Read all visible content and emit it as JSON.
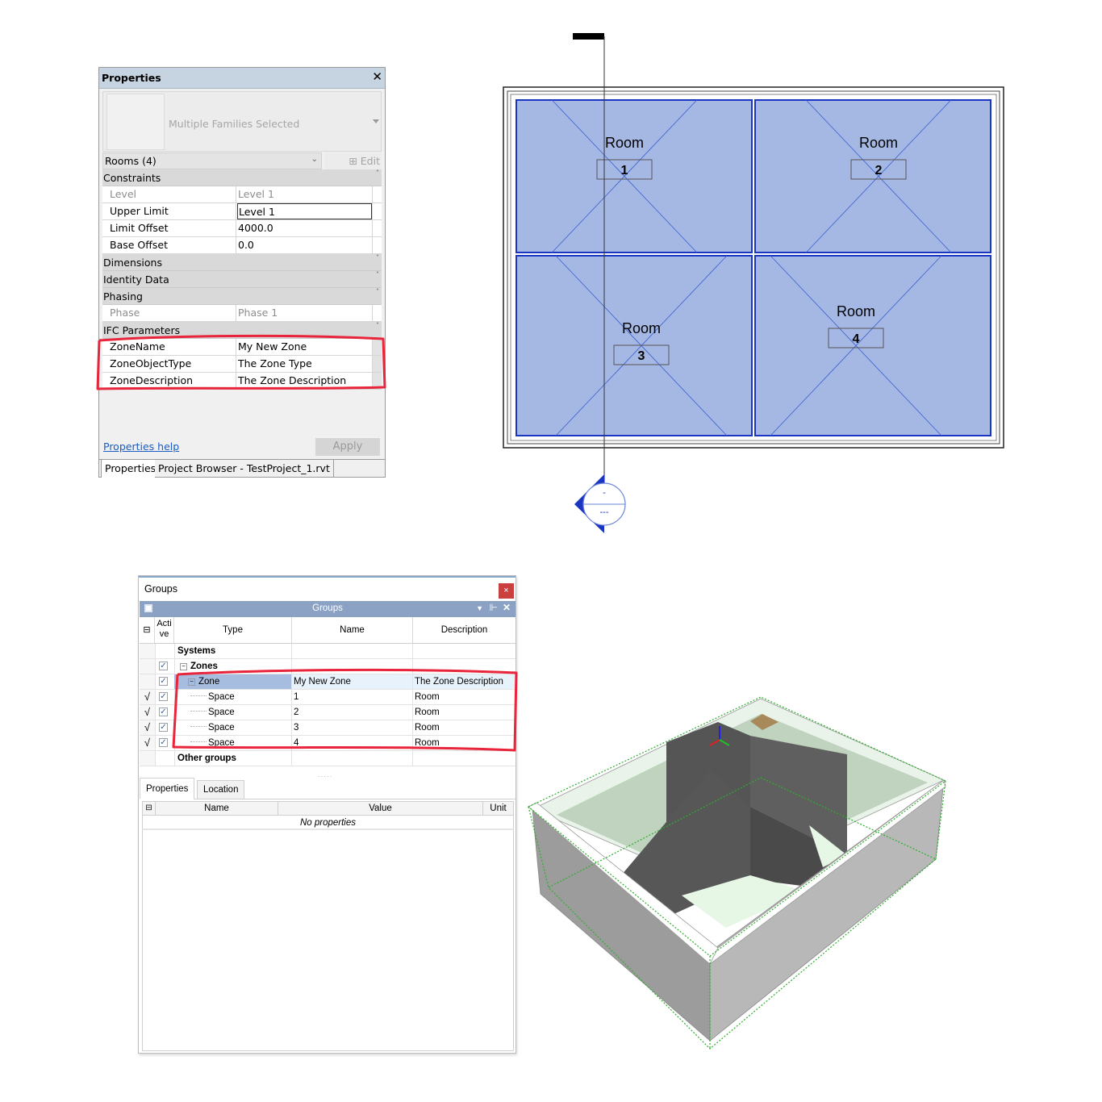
{
  "properties_palette": {
    "title": "Properties",
    "type_selector_label": "Multiple Families Selected",
    "filter_value": "Rooms (4)",
    "edit_type_label": "Edit Type",
    "groups": [
      {
        "label": "Constraints",
        "collapsed": false,
        "rows": [
          {
            "name": "Level",
            "value": "Level 1",
            "disabled": true
          },
          {
            "name": "Upper Limit",
            "value": "Level 1",
            "disabled": false
          },
          {
            "name": "Limit Offset",
            "value": "4000.0",
            "disabled": false
          },
          {
            "name": "Base Offset",
            "value": "0.0",
            "disabled": false
          }
        ]
      },
      {
        "label": "Dimensions",
        "collapsed": true
      },
      {
        "label": "Identity Data",
        "collapsed": true
      },
      {
        "label": "Phasing",
        "collapsed": false,
        "rows": [
          {
            "name": "Phase",
            "value": "Phase 1",
            "disabled": true
          }
        ]
      },
      {
        "label": "IFC Parameters",
        "collapsed": false,
        "rows": [
          {
            "name": "ZoneName",
            "value": "My New Zone",
            "disabled": false
          },
          {
            "name": "ZoneObjectType",
            "value": "The Zone Type",
            "disabled": false
          },
          {
            "name": "ZoneDescription",
            "value": "The Zone Description",
            "disabled": false
          }
        ]
      }
    ],
    "help_link": "Properties help",
    "apply_label": "Apply",
    "tabs": [
      "Properties",
      "Project Browser - TestProject_1.rvt"
    ],
    "close_glyph": "✕"
  },
  "floor_plan": {
    "rooms": [
      {
        "name": "Room",
        "number": "1"
      },
      {
        "name": "Room",
        "number": "2"
      },
      {
        "name": "Room",
        "number": "3"
      },
      {
        "name": "Room",
        "number": "4"
      }
    ],
    "section_marker_top": "-",
    "section_marker_bottom": "---",
    "room_fill_color": "#a5b8e4",
    "room_border_color": "#1a35c2"
  },
  "groups_window": {
    "title": "Groups",
    "panel_title": "Groups",
    "columns": [
      "Acti ve",
      "Type",
      "Name",
      "Description"
    ],
    "rows": [
      {
        "flag": "",
        "checked": null,
        "type": "Systems",
        "name": "",
        "description": "",
        "bold": true,
        "level": 0
      },
      {
        "flag": "",
        "checked": true,
        "type": "Zones",
        "name": "",
        "description": "",
        "bold": true,
        "level": 1,
        "expander": "−"
      },
      {
        "flag": "",
        "checked": true,
        "type": "Zone",
        "name": "My New Zone",
        "description": "The Zone Description",
        "bold": false,
        "level": 2,
        "expander": "−",
        "selected": true
      },
      {
        "flag": "√",
        "checked": true,
        "type": "Space",
        "name": "1",
        "description": "Room",
        "level": 3
      },
      {
        "flag": "√",
        "checked": true,
        "type": "Space",
        "name": "2",
        "description": "Room",
        "level": 3
      },
      {
        "flag": "√",
        "checked": true,
        "type": "Space",
        "name": "3",
        "description": "Room",
        "level": 3
      },
      {
        "flag": "√",
        "checked": true,
        "type": "Space",
        "name": "4",
        "description": "Room",
        "level": 3
      },
      {
        "flag": "",
        "checked": null,
        "type": "Other groups",
        "name": "",
        "description": "",
        "bold": true,
        "level": 0
      }
    ],
    "bottom_tabs": [
      "Properties",
      "Location"
    ],
    "prop_columns": [
      "Name",
      "Value",
      "Unit"
    ],
    "empty_message": "No properties",
    "close_glyph": "×",
    "check_glyph": "✓"
  },
  "model_view": {
    "axis_colors": {
      "x": "#e02020",
      "y": "#20c020",
      "z": "#2020e0"
    }
  }
}
